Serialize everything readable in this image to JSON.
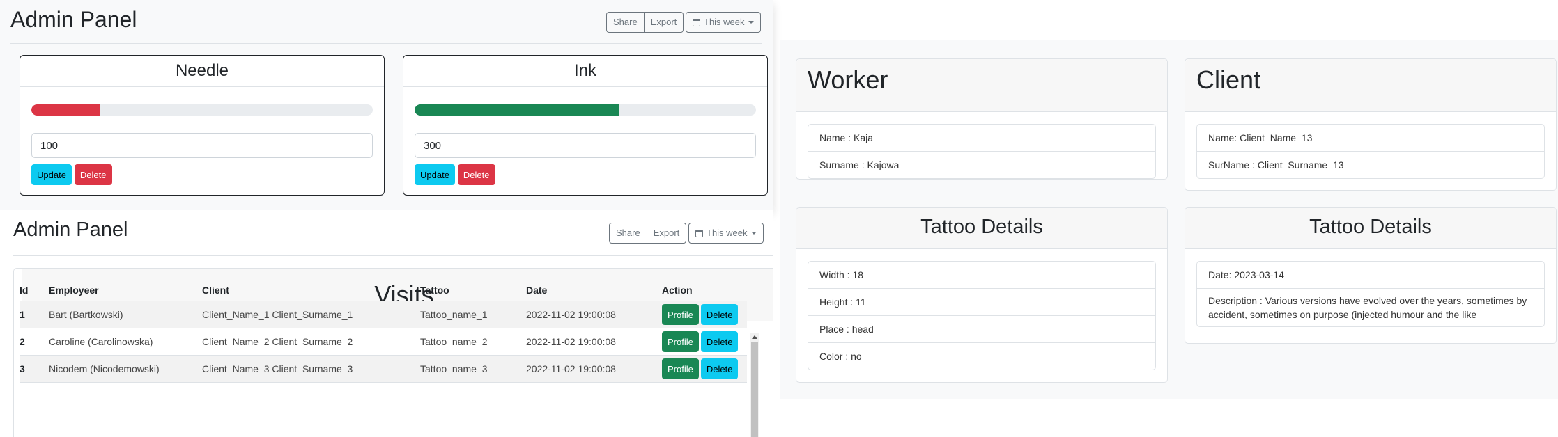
{
  "admin_top": {
    "title": "Admin Panel",
    "share_label": "Share",
    "export_label": "Export",
    "period_label": "This week",
    "resources": [
      {
        "name": "Needle",
        "value": "100",
        "level": 0.2,
        "bar_color": "#dc3545",
        "update_label": "Update",
        "delete_label": "Delete"
      },
      {
        "name": "Ink",
        "value": "300",
        "level": 0.6,
        "bar_color": "#198754",
        "update_label": "Update",
        "delete_label": "Delete"
      }
    ]
  },
  "admin_bottom": {
    "title": "Admin Panel",
    "share_label": "Share",
    "export_label": "Export",
    "period_label": "This week",
    "visits": {
      "heading": "Visits",
      "columns": [
        "Id",
        "Employeer",
        "Client",
        "Tattoo",
        "Date",
        "Action"
      ],
      "rows": [
        {
          "id": "1",
          "employee": "Bart (Bartkowski)",
          "client": "Client_Name_1 Client_Surname_1",
          "tattoo": "Tattoo_name_1",
          "date": "2022-11-02 19:00:08",
          "profile_label": "Profile",
          "delete_label": "Delete"
        },
        {
          "id": "2",
          "employee": "Caroline (Carolinowska)",
          "client": "Client_Name_2 Client_Surname_2",
          "tattoo": "Tattoo_name_2",
          "date": "2022-11-02 19:00:08",
          "profile_label": "Profile",
          "delete_label": "Delete"
        },
        {
          "id": "3",
          "employee": "Nicodem (Nicodemowski)",
          "client": "Client_Name_3 Client_Surname_3",
          "tattoo": "Tattoo_name_3",
          "date": "2022-11-02 19:00:08",
          "profile_label": "Profile",
          "delete_label": "Delete"
        }
      ]
    }
  },
  "details": {
    "worker": {
      "heading": "Worker",
      "items": [
        "Name : Kaja",
        "Surname : Kajowa"
      ]
    },
    "client": {
      "heading": "Client",
      "items": [
        "Name: Client_Name_13",
        "SurName : Client_Surname_13"
      ]
    },
    "tattoo_left": {
      "heading": "Tattoo Details",
      "items": [
        "Width : 18",
        "Height : 11",
        "Place : head",
        "Color : no"
      ]
    },
    "tattoo_right": {
      "heading": "Tattoo Details",
      "items": [
        "Date: 2023-03-14",
        "Description : Various versions have evolved over the years, sometimes by accident, sometimes on purpose (injected humour and the like"
      ]
    }
  },
  "colors": {
    "info": "#0dcaf0",
    "danger": "#dc3545",
    "success": "#198754"
  },
  "icons": {
    "period": "calendar-icon",
    "dropdown": "caret-down-icon"
  }
}
